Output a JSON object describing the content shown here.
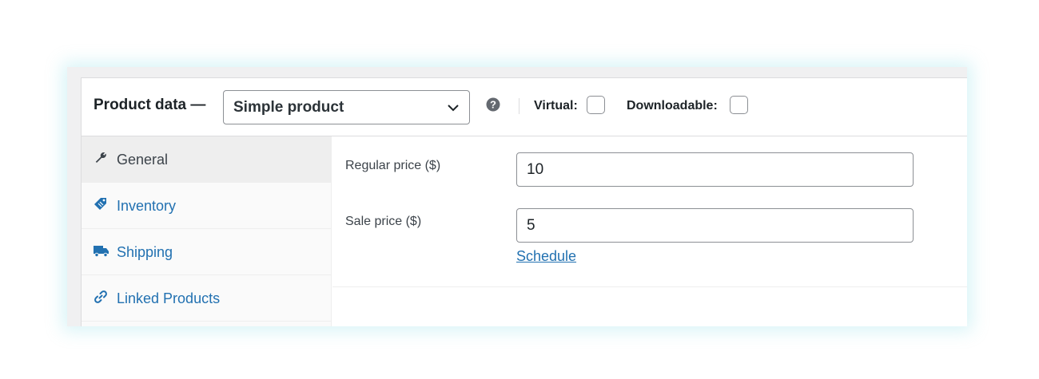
{
  "header": {
    "title": "Product data —",
    "product_type": {
      "selected": "Simple product",
      "options": [
        "Simple product"
      ]
    },
    "virtual_label": "Virtual:",
    "virtual_checked": false,
    "downloadable_label": "Downloadable:",
    "downloadable_checked": false
  },
  "tabs": [
    {
      "label": "General",
      "icon": "wrench-icon",
      "active": true
    },
    {
      "label": "Inventory",
      "icon": "tag-icon",
      "active": false
    },
    {
      "label": "Shipping",
      "icon": "truck-icon",
      "active": false
    },
    {
      "label": "Linked Products",
      "icon": "link-icon",
      "active": false
    }
  ],
  "general": {
    "regular_price_label": "Regular price ($)",
    "regular_price_value": "10",
    "sale_price_label": "Sale price ($)",
    "sale_price_value": "5",
    "schedule_link": "Schedule"
  },
  "colors": {
    "accent": "#2271b1",
    "text": "#1d2327",
    "border": "#8c8f94"
  }
}
